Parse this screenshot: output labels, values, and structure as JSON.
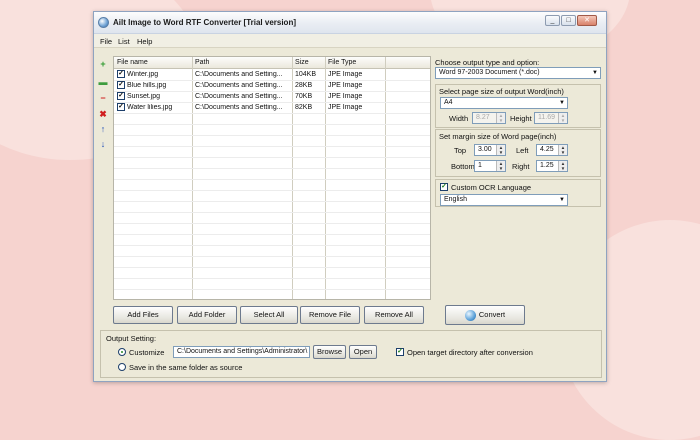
{
  "window": {
    "title": "Ailt Image to Word RTF Converter [Trial version]"
  },
  "menu": [
    "File",
    "List",
    "Help"
  ],
  "table": {
    "headers": [
      "File name",
      "Path",
      "Size",
      "File Type"
    ],
    "rows": [
      {
        "name": "Winter.jpg",
        "path": "C:\\Documents and Setting...",
        "size": "104KB",
        "type": "JPE Image",
        "checked": true
      },
      {
        "name": "Blue hills.jpg",
        "path": "C:\\Documents and Setting...",
        "size": "28KB",
        "type": "JPE Image",
        "checked": true
      },
      {
        "name": "Sunset.jpg",
        "path": "C:\\Documents and Setting...",
        "size": "70KB",
        "type": "JPE Image",
        "checked": true
      },
      {
        "name": "Water lilies.jpg",
        "path": "C:\\Documents and Setting...",
        "size": "82KB",
        "type": "JPE Image",
        "checked": true
      }
    ]
  },
  "side_icons": [
    {
      "name": "add-icon",
      "glyph": "+",
      "color": "#2e9a2e"
    },
    {
      "name": "folder-icon",
      "glyph": "▬",
      "color": "#3e9c3e"
    },
    {
      "name": "remove-icon",
      "glyph": "−",
      "color": "#d01e1e"
    },
    {
      "name": "delete-icon",
      "glyph": "✖",
      "color": "#d01e1e"
    },
    {
      "name": "move-up-icon",
      "glyph": "↑",
      "color": "#1f4fb8"
    },
    {
      "name": "move-down-icon",
      "glyph": "↓",
      "color": "#1f4fb8"
    }
  ],
  "buttons": {
    "add_files": "Add Files",
    "add_folder": "Add Folder",
    "select_all": "Select All",
    "remove_file": "Remove File",
    "remove_all": "Remove All",
    "convert": "Convert"
  },
  "options": {
    "output_type_label": "Choose output type and option:",
    "output_type_value": "Word 97-2003 Document (*.doc)",
    "page_size_label": "Select page size of output Word(inch)",
    "page_size_value": "A4",
    "width_label": "Width",
    "width_value": "8.27",
    "height_label": "Height",
    "height_value": "11.69",
    "margin_label": "Set margin size of Word page(inch)",
    "top_label": "Top",
    "top_value": "3.00",
    "left_label": "Left",
    "left_value": "4.25",
    "bottom_label": "Bottom",
    "bottom_value": "1",
    "right_label": "Right",
    "right_value": "1.25",
    "ocr_label": "Custom OCR Language",
    "ocr_checked": true,
    "ocr_value": "English"
  },
  "output": {
    "group_label": "Output Setting:",
    "customize_label": "Customize",
    "customize_selected": true,
    "path_value": "C:\\Documents and Settings\\Administrator\\",
    "browse_label": "Browse",
    "open_label": "Open",
    "open_target_label": "Open target directory after conversion",
    "open_target_checked": true,
    "same_folder_label": "Save in the same folder as source"
  }
}
